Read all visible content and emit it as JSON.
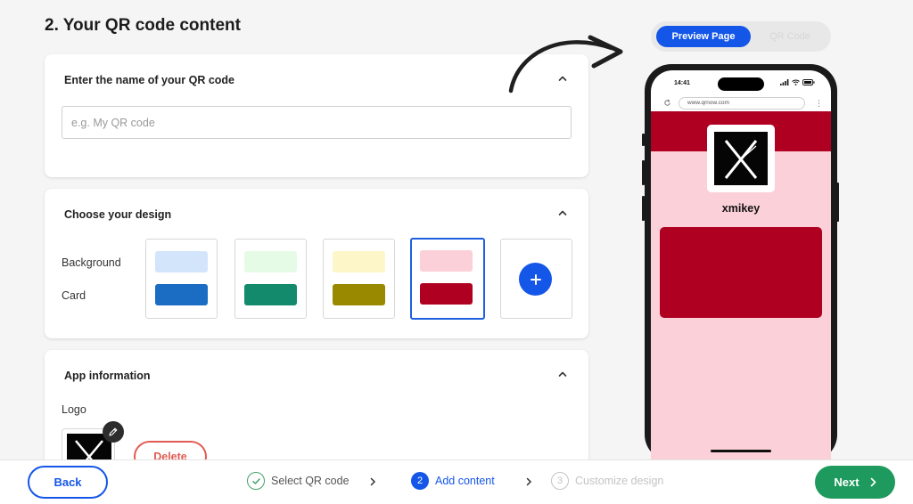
{
  "page": {
    "title": "2. Your QR code content"
  },
  "name_section": {
    "heading": "Enter the name of your QR code",
    "placeholder": "e.g. My QR code",
    "value": ""
  },
  "design_section": {
    "heading": "Choose your design",
    "background_label": "Background",
    "card_label": "Card",
    "swatches": [
      {
        "background": "#d3e5fb",
        "card": "#1b6cc3",
        "selected": false
      },
      {
        "background": "#e5fbe6",
        "card": "#138a6c",
        "selected": false
      },
      {
        "background": "#fcf6c8",
        "card": "#998900",
        "selected": false
      },
      {
        "background": "#fbd0d8",
        "card": "#b00022",
        "selected": true
      }
    ],
    "add_icon": "plus-icon"
  },
  "app_section": {
    "heading": "App information",
    "logo_label": "Logo",
    "delete_label": "Delete"
  },
  "preview": {
    "toggle_active": "Preview Page",
    "toggle_inactive": "QR Code",
    "status_time": "14:41",
    "url": "www.qrnow.com",
    "profile_name": "xmikey",
    "hero_color": "#b00022",
    "page_bg_color": "#fbd0d8",
    "card_color": "#b00022"
  },
  "footer": {
    "back_label": "Back",
    "next_label": "Next",
    "steps": [
      {
        "number": "1",
        "label": "Select QR code",
        "state": "done"
      },
      {
        "number": "2",
        "label": "Add content",
        "state": "active"
      },
      {
        "number": "3",
        "label": "Customize design",
        "state": "upcoming"
      }
    ]
  },
  "colors": {
    "primary": "#1456e8",
    "success": "#1e9a5e",
    "danger": "#e25b52",
    "step_done": "#43a36a",
    "step_upcoming": "#c4c4c4"
  }
}
